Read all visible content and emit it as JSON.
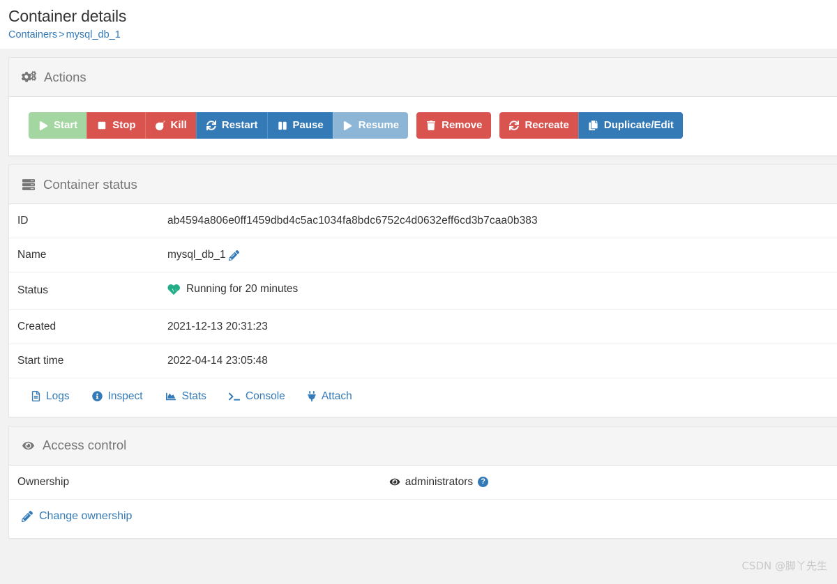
{
  "header": {
    "title": "Container details",
    "breadcrumb": {
      "root": "Containers",
      "separator": ">",
      "current": "mysql_db_1"
    }
  },
  "actions_panel": {
    "title": "Actions",
    "icon": "cogs-icon",
    "buttons": [
      {
        "label": "Start",
        "icon": "play-icon",
        "style": "success-muted",
        "state": "disabled"
      },
      {
        "label": "Stop",
        "icon": "stop-icon",
        "style": "danger",
        "state": "enabled"
      },
      {
        "label": "Kill",
        "icon": "bomb-icon",
        "style": "danger",
        "state": "enabled"
      },
      {
        "label": "Restart",
        "icon": "sync-icon",
        "style": "primary",
        "state": "enabled"
      },
      {
        "label": "Pause",
        "icon": "pause-icon",
        "style": "primary",
        "state": "enabled"
      },
      {
        "label": "Resume",
        "icon": "play-icon",
        "style": "primary-muted",
        "state": "disabled"
      },
      {
        "label": "Remove",
        "icon": "trash-icon",
        "style": "danger",
        "state": "enabled"
      },
      {
        "label": "Recreate",
        "icon": "sync-icon",
        "style": "danger",
        "state": "enabled"
      },
      {
        "label": "Duplicate/Edit",
        "icon": "copy-icon",
        "style": "primary",
        "state": "enabled"
      }
    ]
  },
  "status_panel": {
    "title": "Container status",
    "icon": "server-icon",
    "rows": [
      {
        "label": "ID",
        "value": "ab4594a806e0ff1459dbd4c5ac1034fa8bdc6752c4d0632eff6cd3b7caa0b383"
      },
      {
        "label": "Name",
        "value": "mysql_db_1"
      },
      {
        "label": "Status",
        "value": "Running for 20 minutes"
      },
      {
        "label": "Created",
        "value": "2021-12-13 20:31:23"
      },
      {
        "label": "Start time",
        "value": "2022-04-14 23:05:48"
      }
    ],
    "name_edit_icon": "edit-icon",
    "status_icon": "heartbeat-icon",
    "links": [
      {
        "label": "Logs",
        "icon": "file-icon"
      },
      {
        "label": "Inspect",
        "icon": "info-circle-icon"
      },
      {
        "label": "Stats",
        "icon": "chart-area-icon"
      },
      {
        "label": "Console",
        "icon": "terminal-icon"
      },
      {
        "label": "Attach",
        "icon": "plug-icon"
      }
    ]
  },
  "access_panel": {
    "title": "Access control",
    "icon": "eye-icon",
    "ownership_label": "Ownership",
    "ownership_value": "administrators",
    "ownership_icon": "eye-icon",
    "help_icon": "question-circle-icon",
    "help_glyph": "?",
    "change_ownership_label": "Change ownership",
    "change_ownership_icon": "edit-icon"
  },
  "watermark": "CSDN @脚丫先生",
  "colors": {
    "primary": "#337ab7",
    "danger": "#d9534f",
    "success_muted": "#a3d6a0",
    "primary_muted": "#8cb5d6",
    "status_green": "#23ae89",
    "page_bg": "#f2f2f2",
    "panel_head_bg": "#f5f5f5"
  }
}
